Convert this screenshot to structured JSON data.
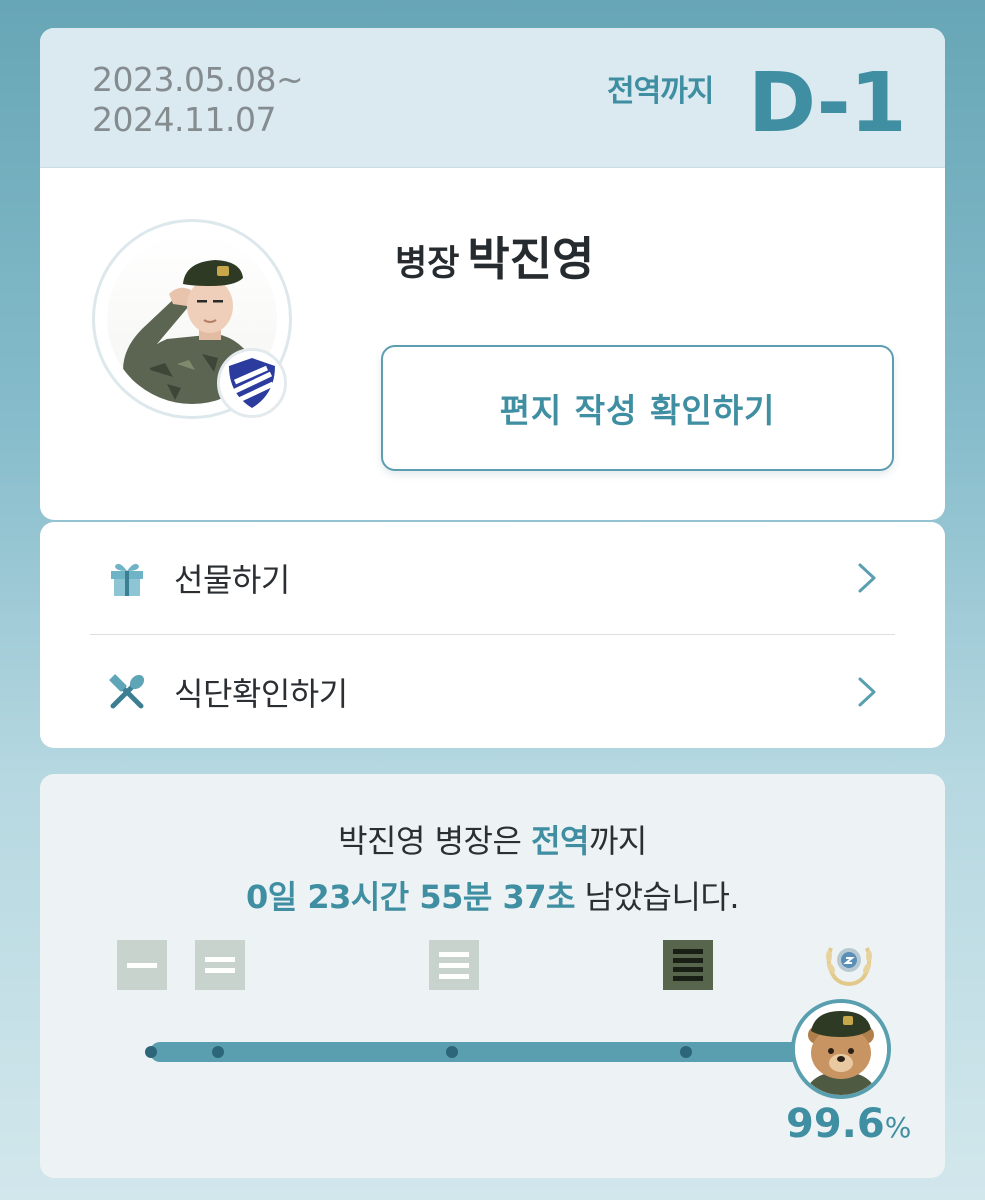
{
  "header": {
    "date_start": "2023.05.08~",
    "date_end": "2024.11.07",
    "dday_caption": "전역까지",
    "dday_value": "D-1"
  },
  "profile": {
    "rank": "병장",
    "name": "박진영",
    "letter_button_label": "편지 작성 확인하기"
  },
  "menu": {
    "items": [
      {
        "label": "선물하기",
        "icon": "gift-icon"
      },
      {
        "label": "식단확인하기",
        "icon": "utensils-icon"
      }
    ]
  },
  "countdown": {
    "line1_prefix": "박진영 병장은 ",
    "line1_accent": "전역",
    "line1_suffix": "까지",
    "line2_accent": "0일 23시간 55분 37초",
    "line2_suffix": " 남았습니다.",
    "rank_icons": [
      "private-rank-icon",
      "private-first-class-rank-icon",
      "corporal-rank-icon",
      "sergeant-rank-icon",
      "discharge-laurel-icon"
    ],
    "progress_fraction": 0.996,
    "percent_value": "99.6",
    "percent_sign": "%"
  },
  "colors": {
    "accent": "#3f8ea2",
    "track": "#5a9fb0",
    "active_rank": "#56654b",
    "inactive_rank": "#c9d3ce"
  }
}
